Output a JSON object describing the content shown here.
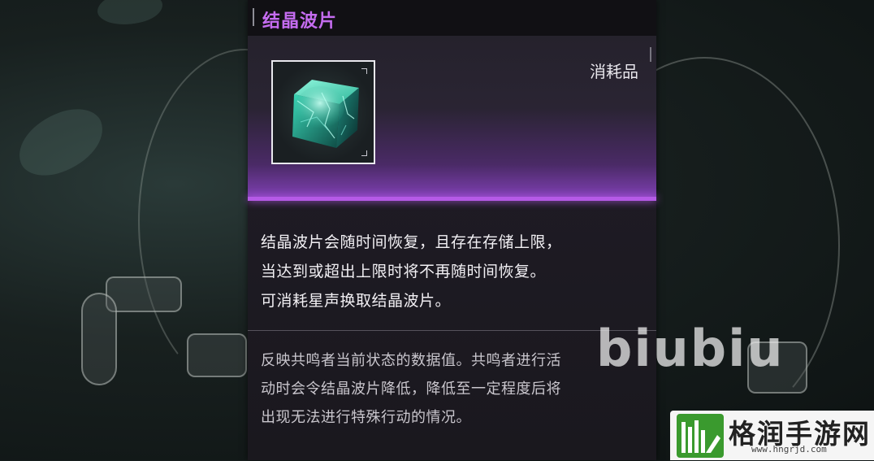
{
  "item": {
    "name": "结晶波片",
    "category": "消耗品",
    "icon": "crystal-cube-icon",
    "rarity_color": "#b55ae6",
    "description_lines": [
      "结晶波片会随时间恢复，且存在存储上限，",
      "当达到或超出上限时将不再随时间恢复。",
      "可消耗星声换取结晶波片。"
    ],
    "detail_lines": [
      "反映共鸣者当前状态的数据值。共鸣者进行活",
      "动时会令结晶波片降低，降低至一定程度后将",
      "出现无法进行特殊行动的情况。"
    ]
  },
  "watermarks": {
    "biubiu": "biubiu",
    "site_name": "格润手游网",
    "site_url": "www.hngrjd.com"
  }
}
